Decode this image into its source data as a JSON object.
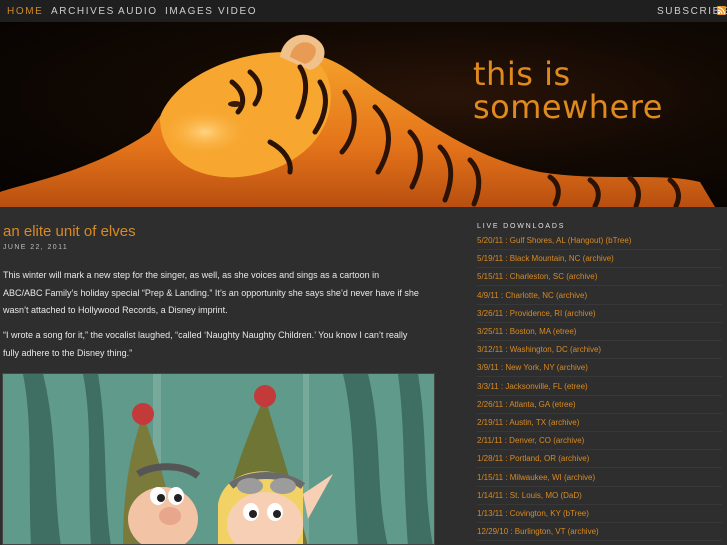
{
  "nav": {
    "items": [
      "HOME",
      "ARCHIVES",
      "AUDIO",
      "IMAGES",
      "VIDEO"
    ],
    "subscribe": "SUBSCRIBE",
    "accent": "#d4891f"
  },
  "header": {
    "brand_line1": "this is",
    "brand_line2": "somewhere"
  },
  "post": {
    "title": "an elite unit of elves",
    "date": "JUNE 22, 2011",
    "para1_line1": "This winter will mark a new step for the singer, as well, as she voices and sings as a cartoon in",
    "para1_line2": "ABC/ABC Family’s holiday special “Prep & Landing.” It’s an opportunity she says she’d never have if she",
    "para1_line3": "wasn’t attached to Hollywood Records, a Disney imprint.",
    "para2_line1": "“I wrote a song for it,” the vocalist laughed, “called ‘Naughty Naughty Children.’ You know I can’t really",
    "para2_line2": "fully adhere to the Disney thing.”"
  },
  "sidebar": {
    "title": "LIVE DOWNLOADS",
    "downloads": [
      "5/20/11 : Gulf Shores, AL (Hangout) (bTree)",
      "5/19/11 : Black Mountain, NC (archive)",
      "5/15/11 : Charleston, SC (archive)",
      "4/9/11 : Charlotte, NC (archive)",
      "3/26/11 : Providence, RI (archive)",
      "3/25/11 : Boston, MA (etree)",
      "3/12/11 : Washington, DC (archive)",
      "3/9/11 : New York, NY (archive)",
      "3/3/11 : Jacksonville, FL (etree)",
      "2/26/11 : Atlanta, GA (etree)",
      "2/19/11 : Austin, TX (archive)",
      "2/11/11 : Denver, CO (archive)",
      "1/28/11 : Portland, OR (archive)",
      "1/15/11 : Milwaukee, WI (archive)",
      "1/14/11 : St. Louis, MO (DaD)",
      "1/13/11 : Covington, KY (bTree)",
      "12/29/10 : Burlington, VT (archive)"
    ]
  },
  "colors": {
    "background": "#2e2e2e",
    "nav_bg": "#1f1f1f",
    "link": "#d98a22"
  }
}
